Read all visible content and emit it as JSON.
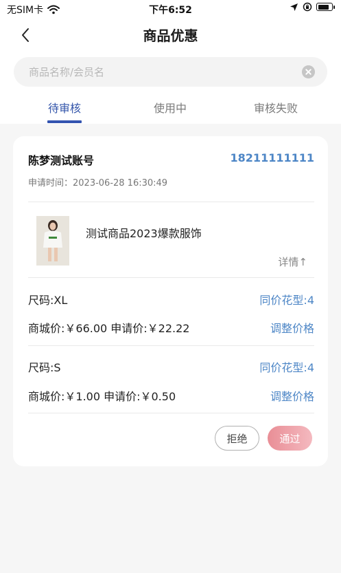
{
  "status_bar": {
    "carrier": "无SIM卡",
    "time": "下午6:52",
    "battery_level": 0.85
  },
  "nav": {
    "title": "商品优惠",
    "back_icon": "chevron-left-icon"
  },
  "search": {
    "placeholder": "商品名称/会员名",
    "value": ""
  },
  "tabs": [
    {
      "label": "待审核",
      "active": true
    },
    {
      "label": "使用中",
      "active": false
    },
    {
      "label": "审核失败",
      "active": false
    }
  ],
  "colors": {
    "accent_blue": "#3354b0",
    "link_blue": "#4d86c6",
    "approve_pink": "#ec9ea5"
  },
  "card": {
    "member_name": "陈梦测试账号",
    "phone": "18211111111",
    "apply_time": "申请时间：2023-06-28 16:30:49",
    "product": {
      "name": "测试商品2023爆款服饰",
      "detail_label": "详情↑"
    },
    "skus": [
      {
        "size": "尺码:XL",
        "same_price": "同价花型:4",
        "price_text": "商城价:￥66.00 申请价:￥22.22",
        "adjust_label": "调整价格"
      },
      {
        "size": "尺码:S",
        "same_price": "同价花型:4",
        "price_text": "商城价:￥1.00 申请价:￥0.50",
        "adjust_label": "调整价格"
      }
    ],
    "reject_label": "拒绝",
    "approve_label": "通过"
  }
}
